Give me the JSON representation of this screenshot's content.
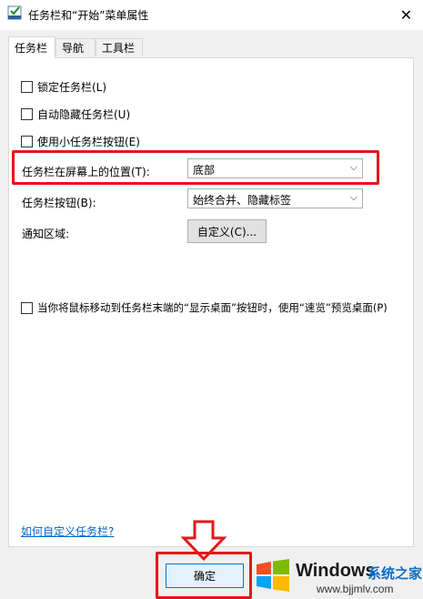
{
  "window": {
    "title": "任务栏和“开始”菜单属性",
    "close_glyph": "✕"
  },
  "tabs": [
    {
      "label": "任务栏",
      "active": true
    },
    {
      "label": "导航",
      "active": false
    },
    {
      "label": "工具栏",
      "active": false
    }
  ],
  "checkboxes": {
    "lock": "锁定任务栏(L)",
    "autohide": "自动隐藏任务栏(U)",
    "small_buttons": "使用小任务栏按钮(E)",
    "peek": "当你将鼠标移动到任务栏末端的“显示桌面”按钮时，使用“速览”预览桌面(P)"
  },
  "fields": {
    "position_label": "任务栏在屏幕上的位置(T):",
    "position_value": "底部",
    "buttons_label": "任务栏按钮(B):",
    "buttons_value": "始终合并、隐藏标签",
    "notify_label": "通知区域:",
    "customize_button": "自定义(C)..."
  },
  "link": "如何自定义任务栏?",
  "ok_button": "确定",
  "watermark": {
    "brand": "Windows",
    "cn": "系统之家",
    "url": "www.bjjmlv.com"
  },
  "colors": {
    "highlight": "#e01818",
    "link": "#0066cc",
    "watermark_accent": "#0b6fc7"
  }
}
